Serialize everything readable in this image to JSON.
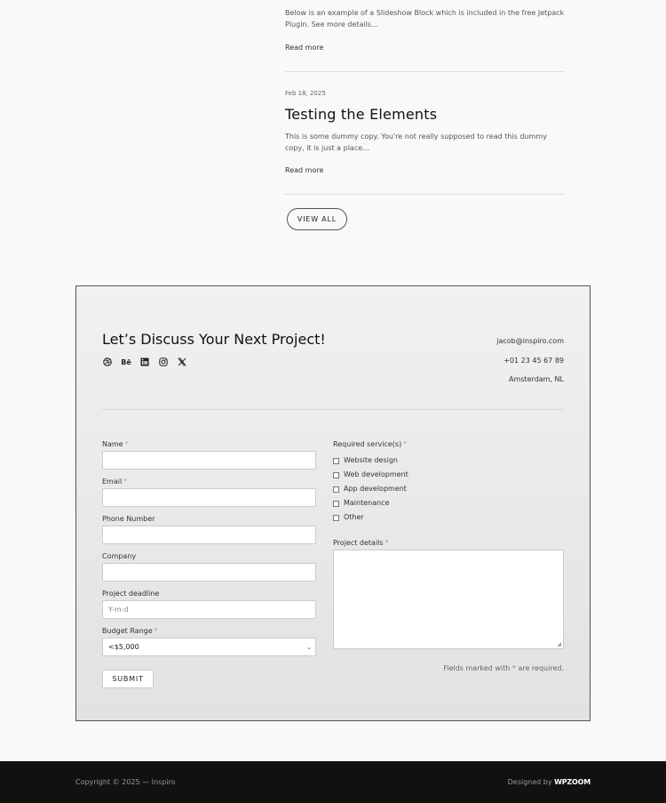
{
  "posts": [
    {
      "excerpt": "Below is an example of a Slideshow Block which is included in the free Jetpack Plugin. See more details…",
      "read_more": "Read more"
    },
    {
      "date": "Feb 18, 2025",
      "title": "Testing the Elements",
      "excerpt": "This is some dummy copy. You're not really supposed to read this dummy copy, it is just a place…",
      "read_more": "Read more"
    }
  ],
  "view_all": "VIEW ALL",
  "contact": {
    "heading": "Let’s Discuss Your Next Project!",
    "socials": [
      "dribbble-icon",
      "behance-icon",
      "linkedin-icon",
      "instagram-icon",
      "x-icon"
    ],
    "email": "jacob@inspiro.com",
    "phone": "+01 23 45 67 89",
    "location": "Amsterdam, NL"
  },
  "form": {
    "name_label": "Name",
    "email_label": "Email",
    "phone_label": "Phone Number",
    "company_label": "Company",
    "deadline_label": "Project deadline",
    "deadline_placeholder": "Y-m-d",
    "budget_label": "Budget Range",
    "budget_value": "<$5,000",
    "services_label": "Required service(s)",
    "services": [
      "Website design",
      "Web development",
      "App development",
      "Maintenance",
      "Other"
    ],
    "details_label": "Project details",
    "required_star": "*",
    "note_before": "Fields marked with ",
    "note_after": " are required.",
    "submit": "SUBMIT"
  },
  "footer": {
    "copyright": "Copyright © 2025 — Inspiro",
    "designed_by": "Designed by ",
    "brand": "WPZOOM"
  }
}
